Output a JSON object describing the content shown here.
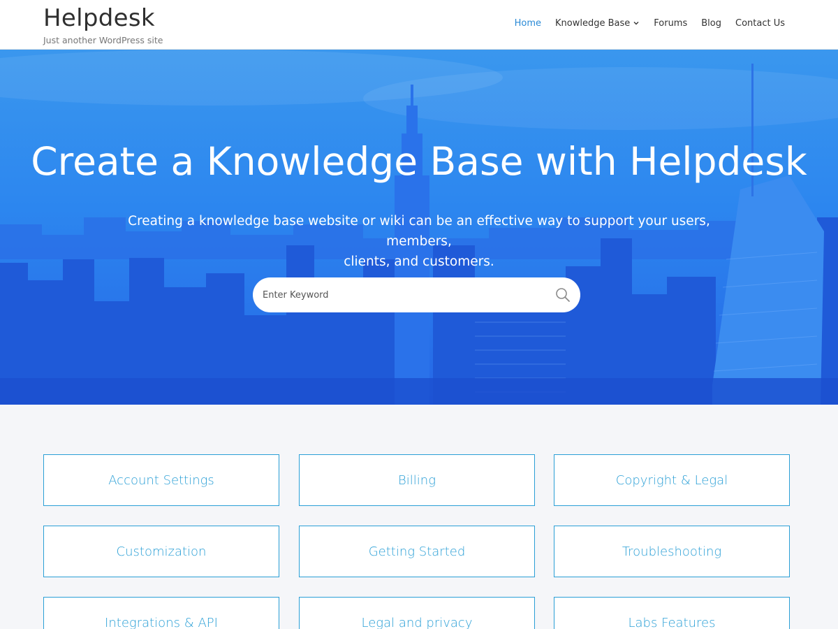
{
  "site": {
    "title": "Helpdesk",
    "tagline": "Just another WordPress site"
  },
  "nav": {
    "items": [
      {
        "label": "Home",
        "active": true
      },
      {
        "label": "Knowledge Base",
        "has_dropdown": true,
        "icon": "chevron-down-icon"
      },
      {
        "label": "Forums"
      },
      {
        "label": "Blog"
      },
      {
        "label": "Contact Us"
      }
    ]
  },
  "hero": {
    "title": "Create a Knowledge Base with Helpdesk",
    "subtitle_line1": "Creating a knowledge base website or wiki can be an effective way to support your users, members,",
    "subtitle_line2": "clients, and customers.",
    "search": {
      "placeholder": "Enter Keyword",
      "value": "",
      "icon": "search-icon"
    }
  },
  "categories": [
    "Account Settings",
    "Billing",
    "Copyright & Legal",
    "Customization",
    "Getting Started",
    "Troubleshooting",
    "Integrations & API",
    "Legal and privacy",
    "Labs Features"
  ],
  "colors": {
    "accent": "#2a9fd6",
    "nav_active": "#2a8ad6",
    "hero_blue": "#1f5ee0",
    "page_bg": "#f5f6f9"
  }
}
